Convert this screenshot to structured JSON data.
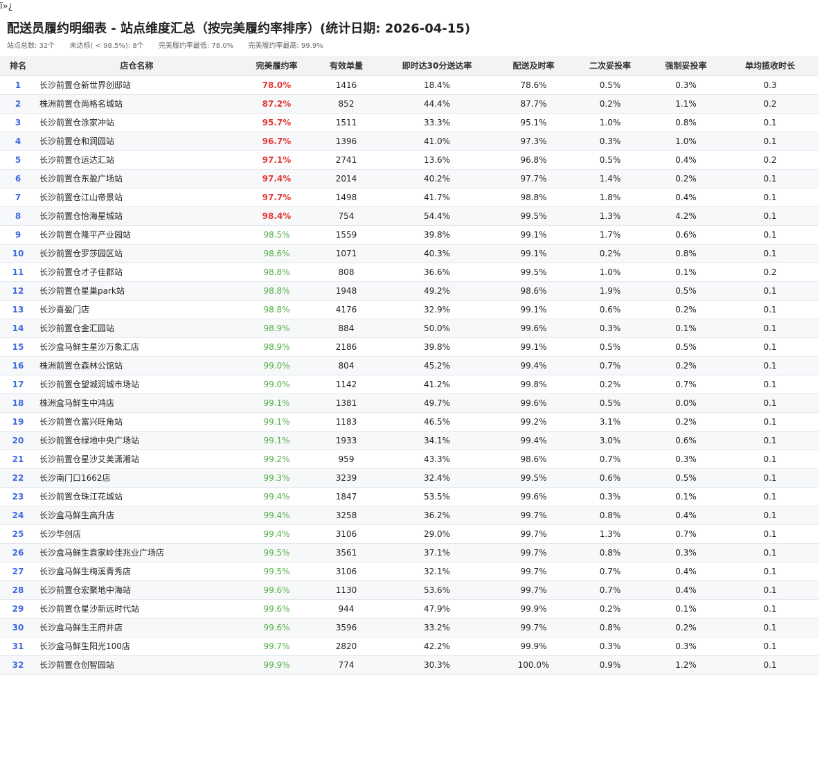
{
  "bom": "ï»¿",
  "title": "配送员履约明细表 - 站点维度汇总（按完美履约率排序）(统计日期: 2026-04-15)",
  "summary": {
    "total": "站点总数: 32个",
    "below": "未达标( < 98.5%): 8个",
    "min": "完美履约率最低: 78.0%",
    "max": "完美履约率最高: 99.9%"
  },
  "colors": {
    "bad": "#e53935",
    "good": "#52b043",
    "rank": "#4169e1"
  },
  "threshold_pct": 98.5,
  "columns": [
    "排名",
    "店仓名称",
    "完美履约率",
    "有效单量",
    "即时达30分送达率",
    "配送及时率",
    "二次妥投率",
    "强制妥投率",
    "单均揽收时长"
  ],
  "rows": [
    [
      "1",
      "长沙前置仓新世界创邸站",
      "78.0%",
      "1416",
      "18.4%",
      "78.6%",
      "0.5%",
      "0.3%",
      "0.3"
    ],
    [
      "2",
      "株洲前置仓尚格名城站",
      "87.2%",
      "852",
      "44.4%",
      "87.7%",
      "0.2%",
      "1.1%",
      "0.2"
    ],
    [
      "3",
      "长沙前置仓涂家冲站",
      "95.7%",
      "1511",
      "33.3%",
      "95.1%",
      "1.0%",
      "0.8%",
      "0.1"
    ],
    [
      "4",
      "长沙前置仓和润园站",
      "96.7%",
      "1396",
      "41.0%",
      "97.3%",
      "0.3%",
      "1.0%",
      "0.1"
    ],
    [
      "5",
      "长沙前置仓运达汇站",
      "97.1%",
      "2741",
      "13.6%",
      "96.8%",
      "0.5%",
      "0.4%",
      "0.2"
    ],
    [
      "6",
      "长沙前置仓东盈广场站",
      "97.4%",
      "2014",
      "40.2%",
      "97.7%",
      "1.4%",
      "0.2%",
      "0.1"
    ],
    [
      "7",
      "长沙前置仓江山帝景站",
      "97.7%",
      "1498",
      "41.7%",
      "98.8%",
      "1.8%",
      "0.4%",
      "0.1"
    ],
    [
      "8",
      "长沙前置仓怡海星城站",
      "98.4%",
      "754",
      "54.4%",
      "99.5%",
      "1.3%",
      "4.2%",
      "0.1"
    ],
    [
      "9",
      "长沙前置仓隆平产业园站",
      "98.5%",
      "1559",
      "39.8%",
      "99.1%",
      "1.7%",
      "0.6%",
      "0.1"
    ],
    [
      "10",
      "长沙前置仓罗莎园区站",
      "98.6%",
      "1071",
      "40.3%",
      "99.1%",
      "0.2%",
      "0.8%",
      "0.1"
    ],
    [
      "11",
      "长沙前置仓才子佳郡站",
      "98.8%",
      "808",
      "36.6%",
      "99.5%",
      "1.0%",
      "0.1%",
      "0.2"
    ],
    [
      "12",
      "长沙前置仓星巢park站",
      "98.8%",
      "1948",
      "49.2%",
      "98.6%",
      "1.9%",
      "0.5%",
      "0.1"
    ],
    [
      "13",
      "长沙喜盈门店",
      "98.8%",
      "4176",
      "32.9%",
      "99.1%",
      "0.6%",
      "0.2%",
      "0.1"
    ],
    [
      "14",
      "长沙前置仓金汇园站",
      "98.9%",
      "884",
      "50.0%",
      "99.6%",
      "0.3%",
      "0.1%",
      "0.1"
    ],
    [
      "15",
      "长沙盒马鲜生星沙万象汇店",
      "98.9%",
      "2186",
      "39.8%",
      "99.1%",
      "0.5%",
      "0.5%",
      "0.1"
    ],
    [
      "16",
      "株洲前置仓森林公馆站",
      "99.0%",
      "804",
      "45.2%",
      "99.4%",
      "0.7%",
      "0.2%",
      "0.1"
    ],
    [
      "17",
      "长沙前置仓望城润城市场站",
      "99.0%",
      "1142",
      "41.2%",
      "99.8%",
      "0.2%",
      "0.7%",
      "0.1"
    ],
    [
      "18",
      "株洲盒马鲜生中鸿店",
      "99.1%",
      "1381",
      "49.7%",
      "99.6%",
      "0.5%",
      "0.0%",
      "0.1"
    ],
    [
      "19",
      "长沙前置仓富兴旺角站",
      "99.1%",
      "1183",
      "46.5%",
      "99.2%",
      "3.1%",
      "0.2%",
      "0.1"
    ],
    [
      "20",
      "长沙前置仓绿地中央广场站",
      "99.1%",
      "1933",
      "34.1%",
      "99.4%",
      "3.0%",
      "0.6%",
      "0.1"
    ],
    [
      "21",
      "长沙前置仓星沙艾美潇湘站",
      "99.2%",
      "959",
      "43.3%",
      "98.6%",
      "0.7%",
      "0.3%",
      "0.1"
    ],
    [
      "22",
      "长沙南门口1662店",
      "99.3%",
      "3239",
      "32.4%",
      "99.5%",
      "0.6%",
      "0.5%",
      "0.1"
    ],
    [
      "23",
      "长沙前置仓珠江花城站",
      "99.4%",
      "1847",
      "53.5%",
      "99.6%",
      "0.3%",
      "0.1%",
      "0.1"
    ],
    [
      "24",
      "长沙盒马鲜生高升店",
      "99.4%",
      "3258",
      "36.2%",
      "99.7%",
      "0.8%",
      "0.4%",
      "0.1"
    ],
    [
      "25",
      "长沙华创店",
      "99.4%",
      "3106",
      "29.0%",
      "99.7%",
      "1.3%",
      "0.7%",
      "0.1"
    ],
    [
      "26",
      "长沙盒马鲜生袁家岭佳兆业广场店",
      "99.5%",
      "3561",
      "37.1%",
      "99.7%",
      "0.8%",
      "0.3%",
      "0.1"
    ],
    [
      "27",
      "长沙盒马鲜生梅溪青秀店",
      "99.5%",
      "3106",
      "32.1%",
      "99.7%",
      "0.7%",
      "0.4%",
      "0.1"
    ],
    [
      "28",
      "长沙前置仓宏聚地中海站",
      "99.6%",
      "1130",
      "53.6%",
      "99.7%",
      "0.7%",
      "0.4%",
      "0.1"
    ],
    [
      "29",
      "长沙前置仓星沙新远时代站",
      "99.6%",
      "944",
      "47.9%",
      "99.9%",
      "0.2%",
      "0.1%",
      "0.1"
    ],
    [
      "30",
      "长沙盒马鲜生王府井店",
      "99.6%",
      "3596",
      "33.2%",
      "99.7%",
      "0.8%",
      "0.2%",
      "0.1"
    ],
    [
      "31",
      "长沙盒马鲜生阳光100店",
      "99.7%",
      "2820",
      "42.2%",
      "99.9%",
      "0.3%",
      "0.3%",
      "0.1"
    ],
    [
      "32",
      "长沙前置仓创智园站",
      "99.9%",
      "774",
      "30.3%",
      "100.0%",
      "0.9%",
      "1.2%",
      "0.1"
    ]
  ]
}
